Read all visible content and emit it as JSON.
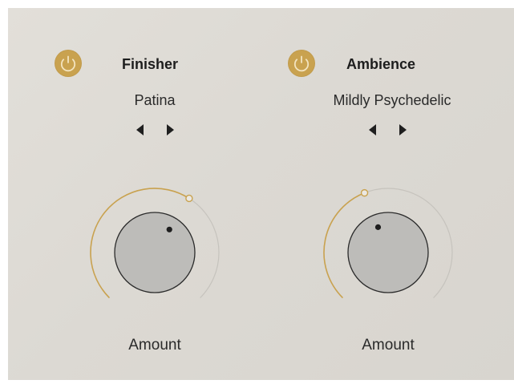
{
  "colors": {
    "accent": "#c9a24f",
    "panel": "#dcd9d3",
    "knob_fill": "#bdbcb9",
    "track": "#c6c3bd"
  },
  "finisher": {
    "title": "Finisher",
    "preset": "Patina",
    "power_icon": "power-icon",
    "prev_icon": "triangle-left-icon",
    "next_icon": "triangle-right-icon",
    "knob_label": "Amount",
    "amount": 0.62
  },
  "ambience": {
    "title": "Ambience",
    "preset": "Mildly Psychedelic",
    "power_icon": "power-icon",
    "prev_icon": "triangle-left-icon",
    "next_icon": "triangle-right-icon",
    "knob_label": "Amount",
    "amount": 0.42
  }
}
